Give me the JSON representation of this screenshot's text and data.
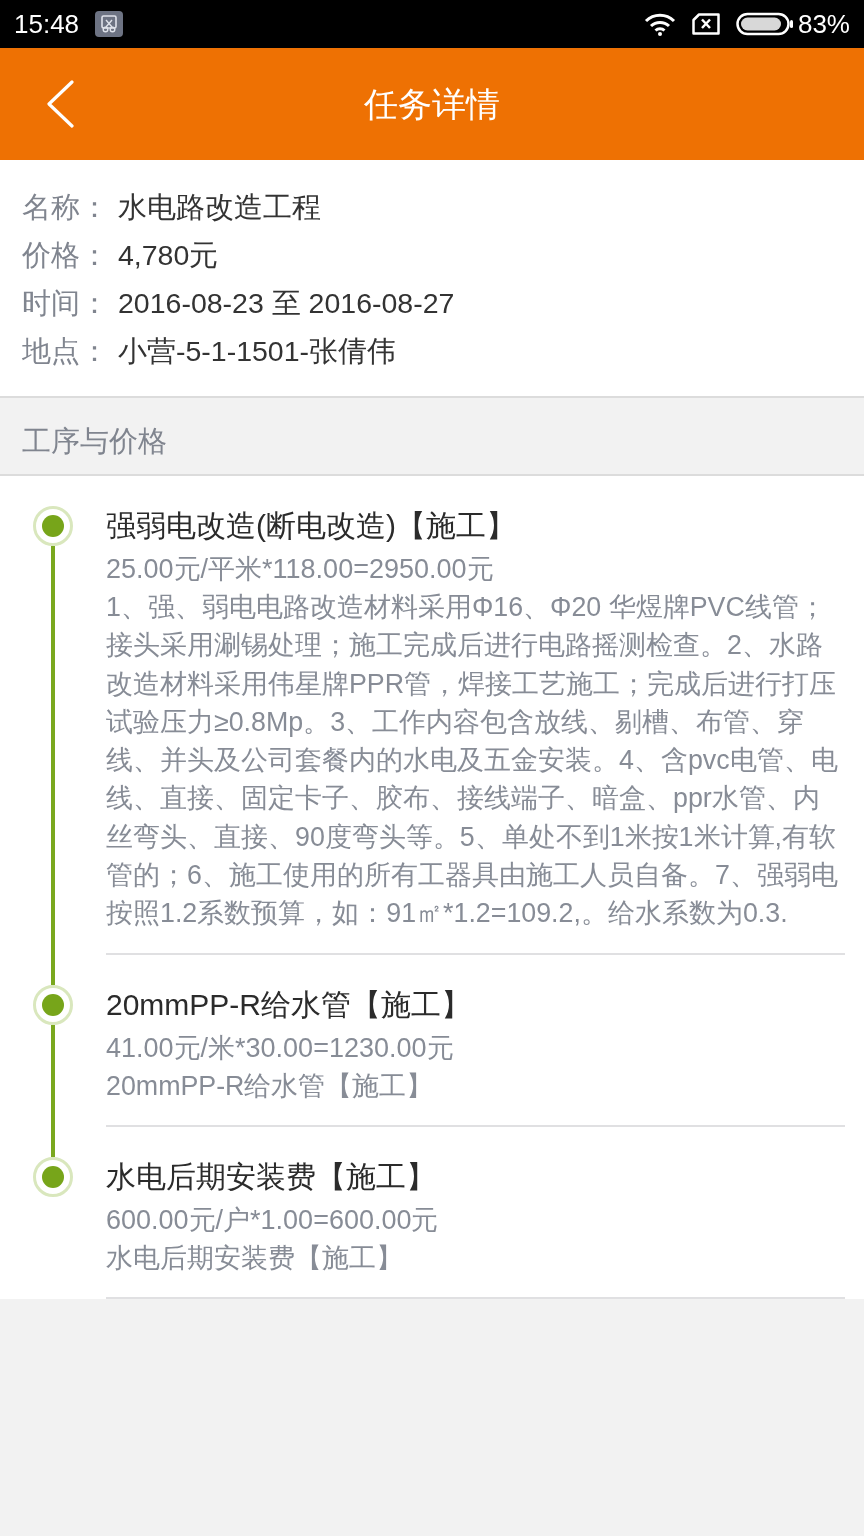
{
  "status_bar": {
    "time": "15:48",
    "battery": "83%"
  },
  "header": {
    "title": "任务详情"
  },
  "info": [
    {
      "label": "名称：",
      "value": "水电路改造工程"
    },
    {
      "label": "价格：",
      "value": "4,780元"
    },
    {
      "label": "时间：",
      "value": "2016-08-23 至 2016-08-27"
    },
    {
      "label": "地点：",
      "value": "小营-5-1-1501-张倩伟"
    }
  ],
  "section": {
    "title": "工序与价格"
  },
  "steps": [
    {
      "title": "强弱电改造(断电改造)【施工】",
      "price": "25.00元/平米*118.00=2950.00元",
      "description": "1、强、弱电电路改造材料采用Φ16、Φ20 华煜牌PVC线管；接头采用涮锡处理；施工完成后进行电路摇测检查。2、水路改造材料采用伟星牌PPR管，焊接工艺施工；完成后进行打压试验压力≥0.8Mp。3、工作内容包含放线、剔槽、布管、穿线、并头及公司套餐内的水电及五金安装。4、含pvc电管、电线、直接、固定卡子、胶布、接线端子、暗盒、ppr水管、内丝弯头、直接、90度弯头等。5、单处不到1米按1米计算,有软管的；6、施工使用的所有工器具由施工人员自备。7、强弱电按照1.2系数预算，如：91㎡*1.2=109.2,。给水系数为0.3."
    },
    {
      "title": "20mmPP-R给水管【施工】",
      "price": "41.00元/米*30.00=1230.00元",
      "description": "20mmPP-R给水管【施工】"
    },
    {
      "title": "水电后期安装费【施工】",
      "price": "600.00元/户*1.00=600.00元",
      "description": "水电后期安装费【施工】"
    }
  ]
}
